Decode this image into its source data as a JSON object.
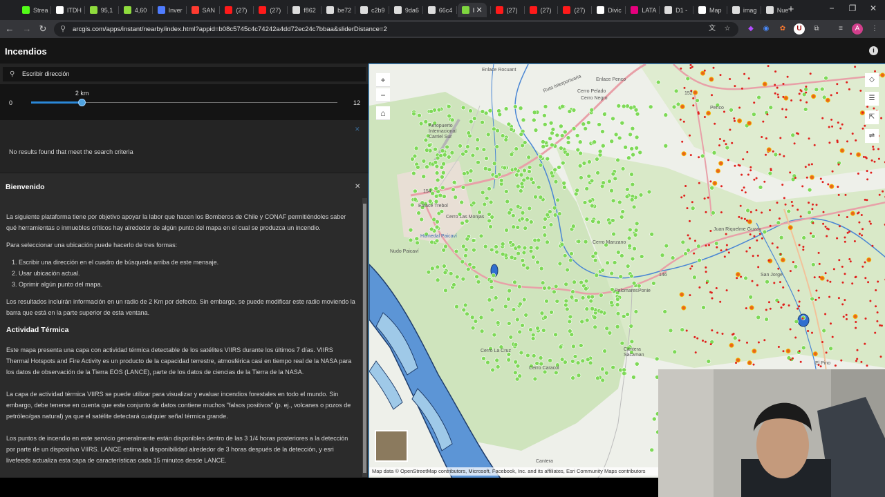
{
  "browser": {
    "tabs": [
      {
        "label": "Strea",
        "icon": "kick-icon",
        "color": "#53fc18"
      },
      {
        "label": "ITDH",
        "icon": "tradingview-icon",
        "color": "#ffffff"
      },
      {
        "label": "95,1",
        "icon": "coin-icon",
        "color": "#8fdc3d"
      },
      {
        "label": "4,60",
        "icon": "coin-icon",
        "color": "#8fdc3d"
      },
      {
        "label": "Inver",
        "icon": "invest-icon",
        "color": "#4f7cff"
      },
      {
        "label": "SAN",
        "icon": "santander-icon",
        "color": "#ff3b30"
      },
      {
        "label": "(27)",
        "icon": "youtube-icon",
        "color": "#ff1a1a"
      },
      {
        "label": "(27)",
        "icon": "youtube-icon",
        "color": "#ff1a1a"
      },
      {
        "label": "f862",
        "icon": "ai-icon",
        "color": "#dddddd"
      },
      {
        "label": "be72",
        "icon": "ai-icon",
        "color": "#dddddd"
      },
      {
        "label": "c2b9",
        "icon": "ai-icon",
        "color": "#dddddd"
      },
      {
        "label": "9da6",
        "icon": "ai-icon",
        "color": "#dddddd"
      },
      {
        "label": "66c4",
        "icon": "ai-icon",
        "color": "#dddddd"
      },
      {
        "label": "I",
        "icon": "arcgis-icon",
        "color": "#7fd63f",
        "active": true
      },
      {
        "label": "(27)",
        "icon": "youtube-icon",
        "color": "#ff1a1a"
      },
      {
        "label": "(27)",
        "icon": "youtube-icon",
        "color": "#ff1a1a"
      },
      {
        "label": "(27)",
        "icon": "youtube-icon",
        "color": "#ff1a1a"
      },
      {
        "label": "Divic",
        "icon": "tradingview-icon",
        "color": "#ffffff"
      },
      {
        "label": "LATA",
        "icon": "latam-icon",
        "color": "#e6007e"
      },
      {
        "label": "D1 -",
        "icon": "ai-icon",
        "color": "#dddddd"
      },
      {
        "label": "Map",
        "icon": "tradingview-icon",
        "color": "#ffffff"
      },
      {
        "label": "imag",
        "icon": "ai-icon",
        "color": "#dddddd"
      },
      {
        "label": "Nue",
        "icon": "chrome-icon",
        "color": "#dddddd"
      }
    ],
    "url": "arcgis.com/apps/instant/nearby/index.html?appid=b08c5745c4c74242a4dd72ec24c7bbaa&sliderDistance=2"
  },
  "app": {
    "title": "Incendios",
    "search": {
      "placeholder": "Escribir dirección"
    },
    "slider": {
      "current_label": "2 km",
      "min": "0",
      "max": "12",
      "value": 2,
      "range": [
        0,
        12
      ]
    },
    "no_results": "No results found that meet the search criteria",
    "welcome": {
      "title": "Bienvenido",
      "intro": "La siguiente plataforma tiene por objetivo apoyar la labor que hacen los Bomberos de Chile y CONAF permitiéndoles saber qué herramientas o inmuebles críticos hay alrededor de algún punto del mapa en el cual se produzca un incendio.",
      "select_intro": "Para seleccionar una ubicación puede hacerlo de tres formas:",
      "steps": [
        "Escribir una dirección en el cuadro de búsqueda arriba de este mensaje.",
        "Usar ubicación actual.",
        "Oprimir algún punto del mapa."
      ],
      "results_note": "Los resultados incluirán información en un radio de 2 Km por defecto. Sin embargo, se puede modificar este radio moviendo la barra que está en la parte superior de esta ventana.",
      "section_title": "Actividad Térmica",
      "para1": "Este mapa presenta una capa con actividad térmica detectable de los satélites VIIRS durante los últimos 7 días. VIIRS Thermal Hotspots and Fire Activity es un producto de la capacidad terrestre, atmosférica casi en tiempo real de la NASA para los datos de observación de la Tierra EOS (LANCE), parte de los datos de ciencias de la Tierra de la NASA.",
      "para2": "La capa de actividad térmica VIIRS se puede utilizar para visualizar y evaluar incendios forestales en todo el mundo. Sin embargo, debe tenerse en cuenta que este conjunto de datos contiene muchos \"falsos positivos\" (p. ej., volcanes o pozos de petróleo/gas natural) ya que el satélite detectará cualquier señal térmica grande.",
      "para3": "Los puntos de incendio en este servicio generalmente están disponibles dentro de las 3 1/4 horas posteriores a la detección por parte de un dispositivo VIIRS. LANCE estima la disponibilidad alrededor de 3 horas después de la detección, y esri livefeeds actualiza esta capa de características cada 15 minutos desde LANCE."
    }
  },
  "map": {
    "attribution": "Map data © OpenStreetMap contributors, Microsoft, Facebook, Inc. and its affiliates, Esri Community Maps contributors",
    "labels": {
      "enlace_rocuant": "Enlace Rocuant",
      "enlace_penco": "Enlace Penco",
      "ruta_interportuaria": "Ruta Interportuaria",
      "cerro_pelado": "Cerro Pelado",
      "cerro_negro": "Cerro Negro",
      "aeropuerto": "Aeropuerto Internacional Carriel Sur",
      "r154": "154",
      "r152": "152",
      "r146": "146",
      "enlace_trebol": "Enlace Trebol",
      "cerro_las_monjas": "Cerro Las Monjas",
      "humedal_paicavi": "Humedal Paicaví",
      "nudo_paicavi": "Nudo Paicaví",
      "cerro_manzano": "Cerro Manzano",
      "juan_riquelme": "Juan Riquelme Guzay",
      "san_jorge": "San Jorge",
      "palomares": "Palomares",
      "ponie": "Ponie",
      "cantera_sacaman": "Cantera Sacaman",
      "el_pino": "El Pino",
      "cerro_la_cruz": "Cerro La Cruz",
      "cerro_caracol": "Cerro Caracol",
      "cantera": "Cantera",
      "penco": "Penco"
    },
    "tools": [
      "zoom-in",
      "zoom-out",
      "home"
    ],
    "right_tools": [
      "locate-icon",
      "list-icon",
      "share-icon",
      "filter-icon"
    ]
  }
}
